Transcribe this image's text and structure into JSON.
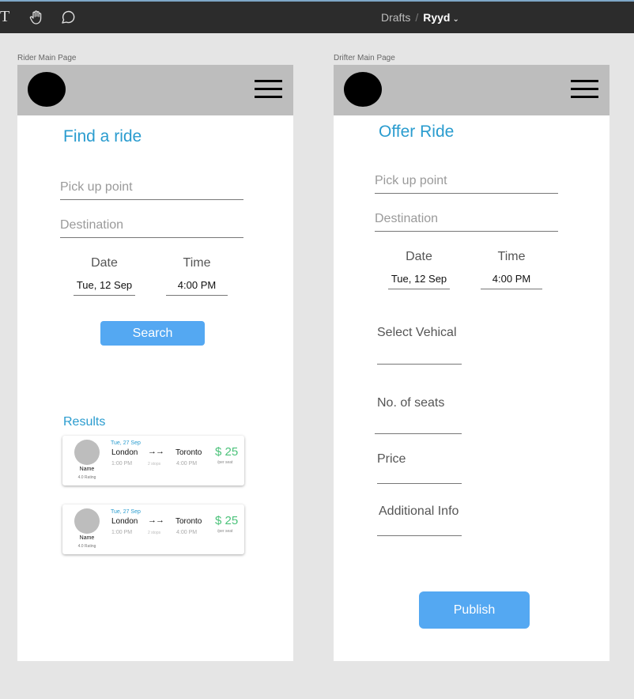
{
  "toolbar": {
    "breadcrumb_parent": "Drafts",
    "breadcrumb_separator": "/",
    "file_name": "Ryyd",
    "tools": [
      "text-tool-icon",
      "hand-tool-icon",
      "comment-tool-icon"
    ]
  },
  "rider": {
    "frame_label": "Rider Main Page",
    "title": "Find a ride",
    "pickup_placeholder": "Pick up point",
    "destination_placeholder": "Destination",
    "date_label": "Date",
    "time_label": "Time",
    "date_value": "Tue, 12 Sep",
    "time_value": "4:00 PM",
    "search_label": "Search",
    "results_title": "Results",
    "results": [
      {
        "date": "Tue, 27 Sep",
        "from": "London",
        "to": "Toronto",
        "depart": "1:00 PM",
        "arrive": "4:00 PM",
        "stops": "2 stops",
        "price": "$ 25",
        "per_seat": "/per seat",
        "name": "Name",
        "rating": "4.0 Rating"
      },
      {
        "date": "Tue, 27 Sep",
        "from": "London",
        "to": "Toronto",
        "depart": "1:00 PM",
        "arrive": "4:00 PM",
        "stops": "2 stops",
        "price": "$ 25",
        "per_seat": "/per seat",
        "name": "Name",
        "rating": "4.0 Rating"
      }
    ]
  },
  "drifter": {
    "frame_label": "Drifter Main Page",
    "title": "Offer Ride",
    "pickup_placeholder": "Pick up point",
    "destination_placeholder": "Destination",
    "date_label": "Date",
    "time_label": "Time",
    "date_value": "Tue, 12 Sep",
    "time_value": "4:00 PM",
    "vehicle_label": "Select Vehical",
    "seats_label": "No. of seats",
    "price_label": "Price",
    "info_label": "Additional Info",
    "publish_label": "Publish"
  },
  "colors": {
    "accent": "#2a9ccf",
    "button": "#54a8f2",
    "price": "#4bc27a",
    "header": "#bdbdbd",
    "toolbar": "#2c2c2c"
  }
}
